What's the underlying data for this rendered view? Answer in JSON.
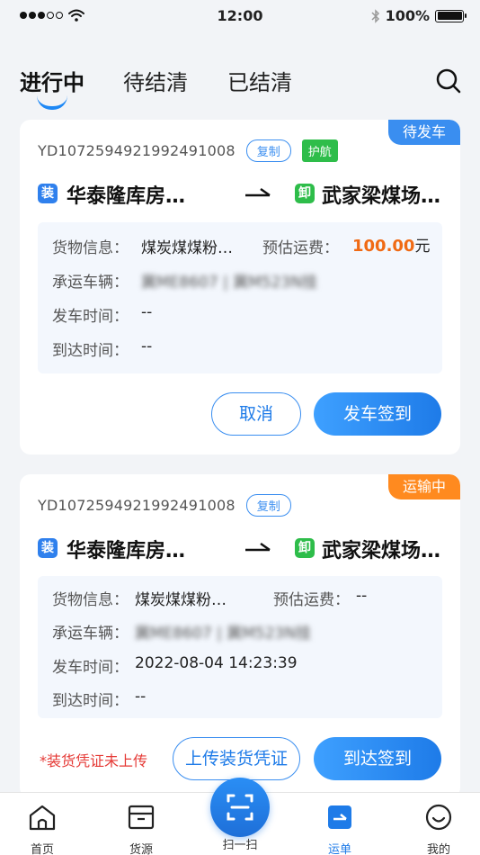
{
  "status_bar": {
    "time": "12:00",
    "battery": "100%"
  },
  "tabs": [
    {
      "label": "进行中",
      "active": true
    },
    {
      "label": "待结清",
      "active": false
    },
    {
      "label": "已结清",
      "active": false
    }
  ],
  "cards": [
    {
      "badge": "待发车",
      "badge_color": "#3a8ef0",
      "order_no": "YD1072594921992491008",
      "copy_label": "复制",
      "escort_label": "护航",
      "load_tag": "装",
      "unload_tag": "卸",
      "origin": "华泰隆库房…",
      "destination": "武家梁煤场…",
      "goods_label": "货物信息：",
      "goods_value": "煤炭煤煤粉…",
      "freight_label": "预估运费：",
      "freight_value": "100.00",
      "freight_unit": "元",
      "vehicle_label": "承运车辆：",
      "vehicle_value": "冀ME8607 | 冀M523N挂",
      "depart_label": "发车时间：",
      "depart_value": "--",
      "arrive_label": "到达时间：",
      "arrive_value": "--",
      "secondary_button": "取消",
      "primary_button": "发车签到"
    },
    {
      "badge": "运输中",
      "badge_color": "#ff8a1f",
      "order_no": "YD1072594921992491008",
      "copy_label": "复制",
      "load_tag": "装",
      "unload_tag": "卸",
      "origin": "华泰隆库房…",
      "destination": "武家梁煤场…",
      "goods_label": "货物信息：",
      "goods_value": "煤炭煤煤粉…",
      "freight_label": "预估运费：",
      "freight_value": "--",
      "vehicle_label": "承运车辆：",
      "vehicle_value": "冀ME8607 | 冀M523N挂",
      "depart_label": "发车时间：",
      "depart_value": "2022-08-04 14:23:39",
      "arrive_label": "到达时间：",
      "arrive_value": "--",
      "warning": "*装货凭证未上传",
      "secondary_button": "上传装货凭证",
      "primary_button": "到达签到"
    }
  ],
  "bottom_nav": [
    {
      "label": "首页",
      "icon": "home-icon"
    },
    {
      "label": "货源",
      "icon": "box-icon"
    },
    {
      "label": "扫一扫",
      "icon": "scan-icon"
    },
    {
      "label": "运单",
      "icon": "waybill-icon",
      "active": true
    },
    {
      "label": "我的",
      "icon": "smile-icon"
    }
  ],
  "colors": {
    "accent": "#1e7be8",
    "price": "#f06a14",
    "warning": "#e53935",
    "escort": "#2ebd4a"
  }
}
